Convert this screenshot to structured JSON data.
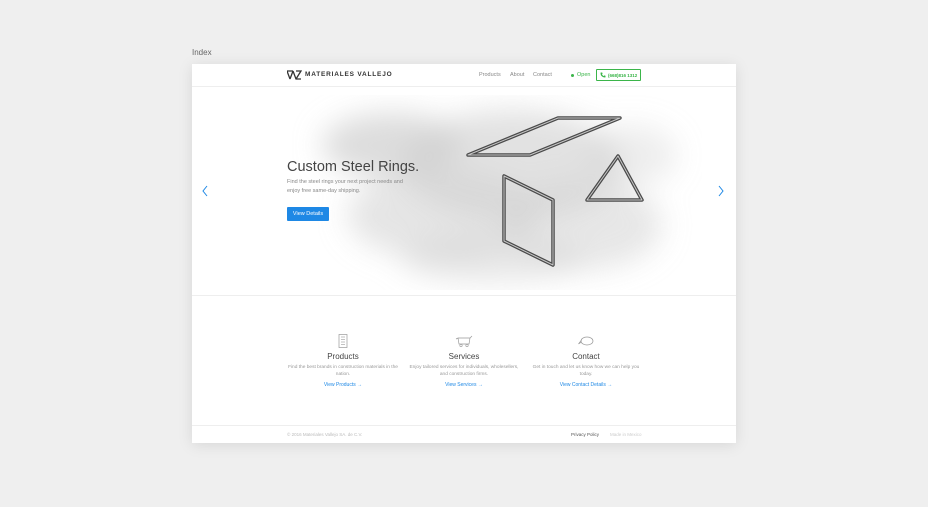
{
  "artboard": {
    "label": "Index"
  },
  "header": {
    "brand": "MATERIALES VALLEJO",
    "nav": [
      "Products",
      "About",
      "Contact"
    ],
    "status": "Open",
    "phone": "(668)816 1312"
  },
  "hero": {
    "title": "Custom Steel Rings.",
    "text": "Find the steel rings your next project needs and enjoy free same-day shipping.",
    "cta": "View Details"
  },
  "features": [
    {
      "icon": "document-icon",
      "title": "Products",
      "text": "Find the best brands in construction materials in the nation.",
      "link": "View Products →"
    },
    {
      "icon": "truck-icon",
      "title": "Services",
      "text": "Enjoy tailored services for individuals, wholesellers, and construction firms.",
      "link": "View Services →"
    },
    {
      "icon": "chat-icon",
      "title": "Contact",
      "text": "Get in touch and let us know how we can help you today.",
      "link": "View Contact Details →"
    }
  ],
  "footer": {
    "copyright": "© 2016 Materiales Vallejo SA. de C.V.",
    "privacy": "Privacy Policy",
    "made_in": "Made in Mexico"
  },
  "colors": {
    "accent": "#1e88e5",
    "status": "#3bb54a"
  }
}
